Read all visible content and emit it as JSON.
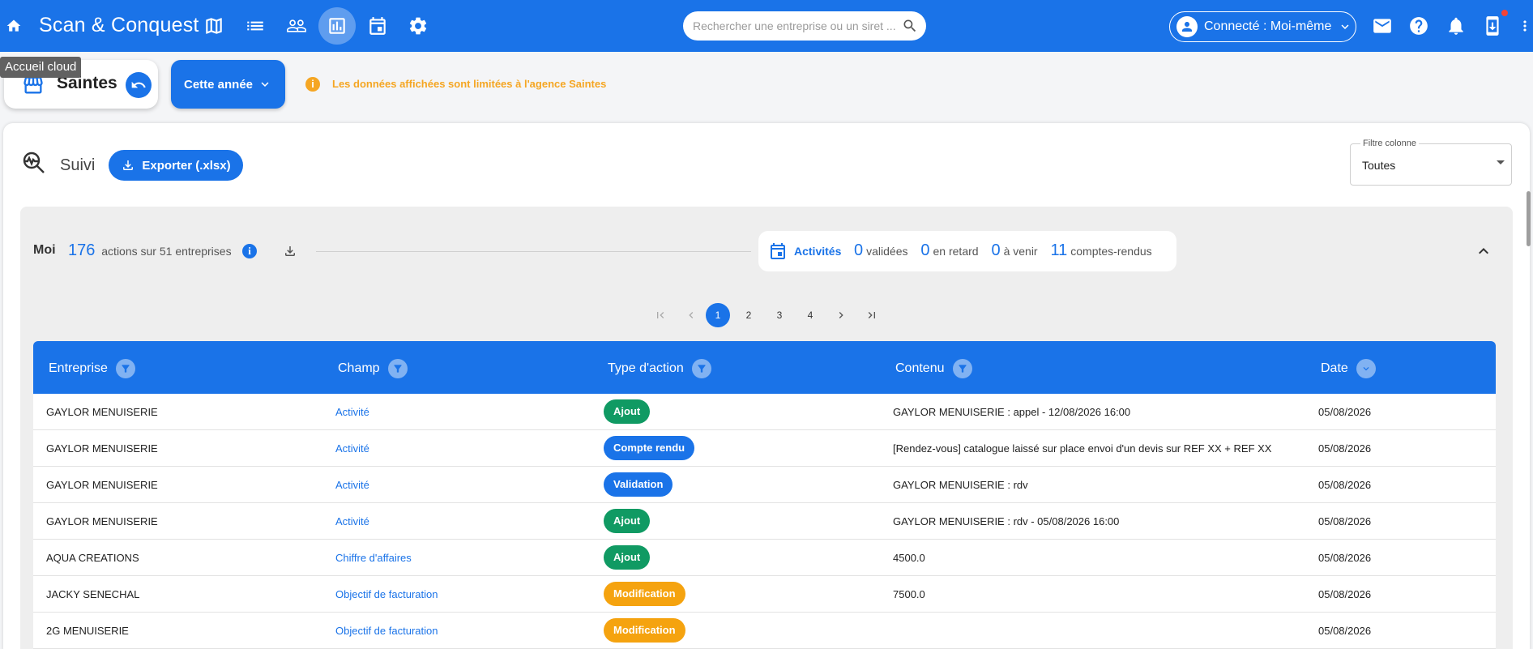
{
  "app": {
    "title": "Scan & Conquest"
  },
  "topbar": {
    "icons": [
      "home-icon",
      "map-icon",
      "list-icon",
      "people-icon",
      "analytics-icon",
      "calendar-icon",
      "settings-icon"
    ],
    "search_placeholder": "Rechercher une entreprise ou un siret ...",
    "user_label": "Connecté : Moi-même",
    "right_icons": [
      "mail-icon",
      "help-icon",
      "bell-icon",
      "download-app-icon",
      "more-vert-icon"
    ]
  },
  "tooltip": "Accueil cloud",
  "subheader": {
    "agency": "Saintes",
    "period": "Cette année",
    "warning": "Les données affichées sont limitées à l'agence Saintes"
  },
  "suivi": {
    "title": "Suivi",
    "export_label": "Exporter (.xlsx)",
    "filter_label": "Filtre colonne",
    "filter_value": "Toutes"
  },
  "summary": {
    "user": "Moi",
    "actions_count": "176",
    "actions_text": "actions sur 51 entreprises",
    "activities_label": "Activités",
    "validated_count": "0",
    "validated_text": "validées",
    "late_count": "0",
    "late_text": "en retard",
    "upcoming_count": "0",
    "upcoming_text": "à venir",
    "reports_count": "11",
    "reports_text": "comptes-rendus"
  },
  "pagination": {
    "pages": [
      "1",
      "2",
      "3",
      "4"
    ],
    "current": "1"
  },
  "table": {
    "headers": {
      "entreprise": "Entreprise",
      "champ": "Champ",
      "type": "Type d'action",
      "contenu": "Contenu",
      "date": "Date"
    },
    "rows": [
      {
        "entreprise": "GAYLOR MENUISERIE",
        "champ": "Activité",
        "type": "Ajout",
        "contenu": "GAYLOR MENUISERIE : appel - 12/08/2026 16:00",
        "date": "05/08/2026"
      },
      {
        "entreprise": "GAYLOR MENUISERIE",
        "champ": "Activité",
        "type": "Compte rendu",
        "contenu": "[Rendez-vous] catalogue laissé sur place envoi d'un devis sur REF XX + REF XX",
        "date": "05/08/2026"
      },
      {
        "entreprise": "GAYLOR MENUISERIE",
        "champ": "Activité",
        "type": "Validation",
        "contenu": "GAYLOR MENUISERIE : rdv",
        "date": "05/08/2026"
      },
      {
        "entreprise": "GAYLOR MENUISERIE",
        "champ": "Activité",
        "type": "Ajout",
        "contenu": "GAYLOR MENUISERIE : rdv - 05/08/2026 16:00",
        "date": "05/08/2026"
      },
      {
        "entreprise": "AQUA CREATIONS",
        "champ": "Chiffre d'affaires",
        "type": "Ajout",
        "contenu": "4500.0",
        "date": "05/08/2026"
      },
      {
        "entreprise": "JACKY SENECHAL",
        "champ": "Objectif de facturation",
        "type": "Modification",
        "contenu": "7500.0",
        "date": "05/08/2026"
      },
      {
        "entreprise": "2G MENUISERIE",
        "champ": "Objectif de facturation",
        "type": "Modification",
        "contenu": "",
        "date": "05/08/2026"
      }
    ]
  },
  "badge_colors": {
    "Ajout": "#109a63",
    "Compte rendu": "#1a73e8",
    "Validation": "#1a73e8",
    "Modification": "#f5a30f"
  },
  "colors": {
    "primary": "#1a73e8",
    "warning": "#f5a623"
  }
}
